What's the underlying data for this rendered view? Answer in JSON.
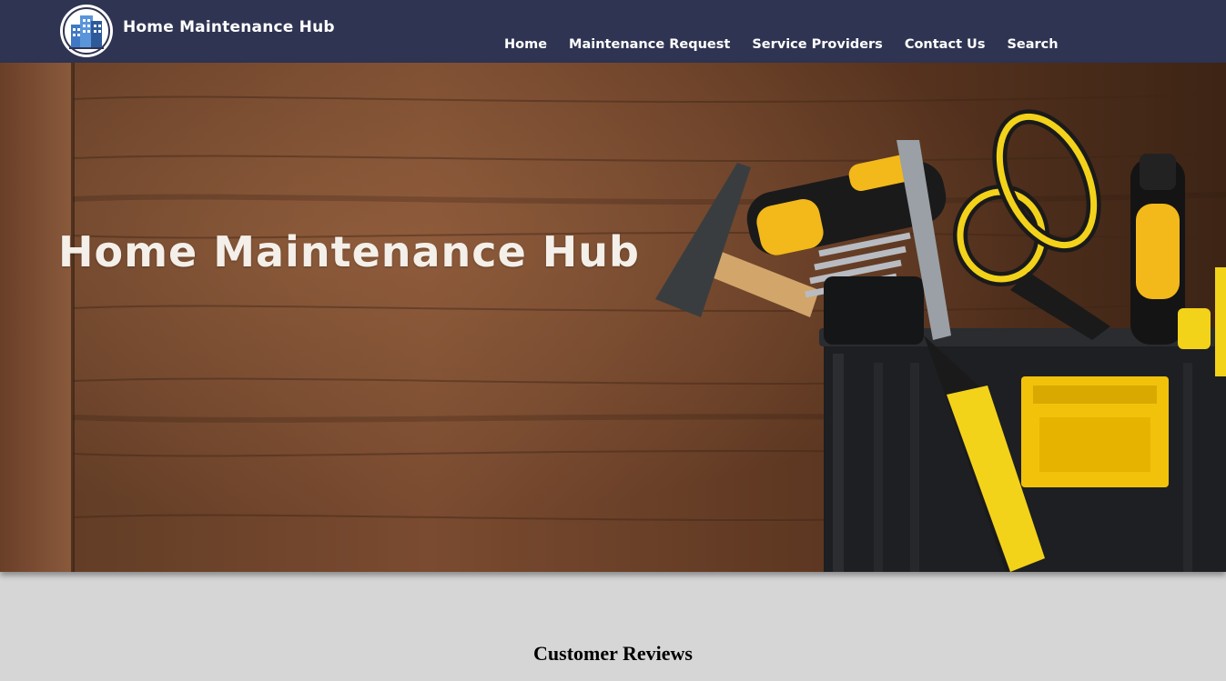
{
  "header": {
    "brand": "Home Maintenance Hub",
    "logo_icon": "building-logo-icon",
    "background": "#2f3452",
    "nav": [
      {
        "label": "Home"
      },
      {
        "label": "Maintenance Request"
      },
      {
        "label": "Service Providers"
      },
      {
        "label": "Contact Us"
      },
      {
        "label": "Search"
      }
    ]
  },
  "hero": {
    "title": "Home Maintenance Hub",
    "image": "toolbox-with-tools-on-wood-background"
  },
  "reviews": {
    "heading": "Customer Reviews",
    "background": "#d6d6d6"
  }
}
